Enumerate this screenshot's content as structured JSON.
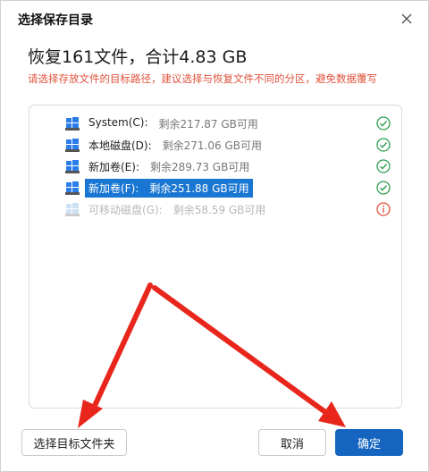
{
  "dialog": {
    "title": "选择保存目录",
    "headline": "恢复161文件，合计4.83 GB",
    "hint": "请选择存放文件的目标路径，建议选择与恢复文件不同的分区，避免数据覆写",
    "colors": {
      "accent": "#1565c0",
      "selected": "#1976d2",
      "warning": "#e0533d",
      "ok": "#2e9e4f",
      "error": "#e0533d"
    }
  },
  "drives": [
    {
      "name": "System(C):",
      "free": "剩余217.87 GB可用",
      "status": "check-icon",
      "state": "normal"
    },
    {
      "name": "本地磁盘(D):",
      "free": "剩余271.06 GB可用",
      "status": "check-icon",
      "state": "normal"
    },
    {
      "name": "新加卷(E):",
      "free": "剩余289.73 GB可用",
      "status": "check-icon",
      "state": "normal"
    },
    {
      "name": "新加卷(F):",
      "free": "剩余251.88 GB可用",
      "status": "check-icon",
      "state": "selected"
    },
    {
      "name": "可移动磁盘(G):",
      "free": "剩余58.59 GB可用",
      "status": "info-error-icon",
      "state": "disabled"
    }
  ],
  "buttons": {
    "choose_folder": "选择目标文件夹",
    "cancel": "取消",
    "ok": "确定"
  }
}
